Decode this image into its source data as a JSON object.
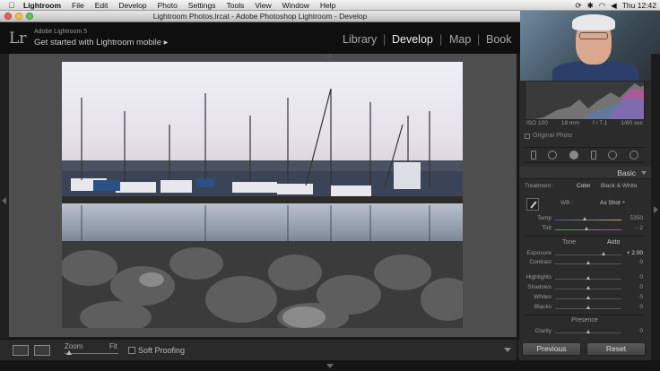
{
  "menubar": {
    "items": [
      "Lightroom",
      "File",
      "Edit",
      "Develop",
      "Photo",
      "Settings",
      "Tools",
      "View",
      "Window",
      "Help"
    ],
    "clock": "Thu 12:42"
  },
  "window": {
    "title": "Lightroom Photos.lrcat - Adobe Photoshop Lightroom - Develop"
  },
  "header": {
    "logo": "Lr",
    "product": "Adobe Lightroom 5",
    "mobile_link": "Get started with Lightroom mobile ▸"
  },
  "modules": [
    {
      "label": "Library",
      "active": false
    },
    {
      "label": "Develop",
      "active": true
    },
    {
      "label": "Map",
      "active": false
    },
    {
      "label": "Book",
      "active": false
    }
  ],
  "toolbar": {
    "zoom_label": "Zoom",
    "fit_label": "Fit",
    "soft_proofing": "Soft Proofing"
  },
  "histogram": {
    "iso": "ISO 100",
    "focal": "18 mm",
    "aperture": "f / 7.1",
    "shutter": "1/60 sec",
    "original_photo": "Original Photo"
  },
  "basic": {
    "title": "Basic",
    "treatment_label": "Treatment :",
    "color": "Color",
    "bw": "Black & White",
    "wb_label": "WB :",
    "wb_value": "As Shot ÷",
    "temp": {
      "label": "Temp",
      "value": "5350",
      "pos": 0.45
    },
    "tint": {
      "label": "Tint",
      "value": "- 2",
      "pos": 0.48
    },
    "tone_label": "Tone",
    "auto_label": "Auto",
    "sliders": [
      {
        "label": "Exposure",
        "value": "+ 2.00",
        "pos": 0.74
      },
      {
        "label": "Contrast",
        "value": "0",
        "pos": 0.5
      },
      {
        "label": "Highlights",
        "value": "0",
        "pos": 0.5
      },
      {
        "label": "Shadows",
        "value": "0",
        "pos": 0.5
      },
      {
        "label": "Whites",
        "value": "0",
        "pos": 0.5
      },
      {
        "label": "Blacks",
        "value": "0",
        "pos": 0.5
      }
    ],
    "presence_label": "Presence",
    "clarity": {
      "label": "Clarity",
      "value": "0",
      "pos": 0.5
    }
  },
  "buttons": {
    "previous": "Previous",
    "reset": "Reset"
  },
  "colors": {
    "accent_text": "#dddddd",
    "panel_bg": "#2b2b2b",
    "viewer_bg": "#4e4e4e"
  }
}
